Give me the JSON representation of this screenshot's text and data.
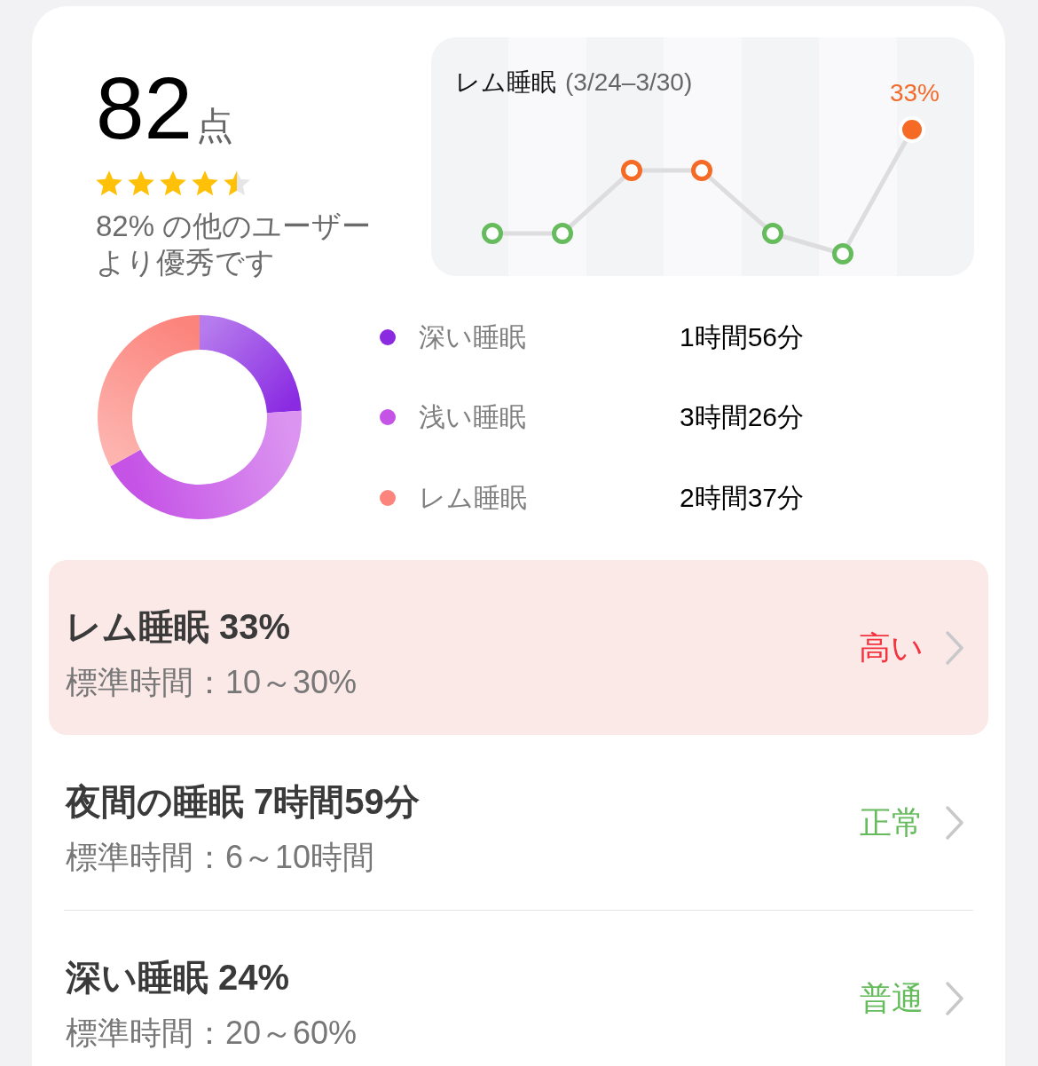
{
  "score": {
    "value": "82",
    "unit": "点",
    "stars": 4.5,
    "caption": "82% の他のユーザーより優秀です"
  },
  "rem_chart": {
    "title": "レム睡眠",
    "date_range": "(3/24–3/30)",
    "value_label": "33%"
  },
  "breakdown": {
    "chart_data": {
      "type": "donut",
      "values": [
        24,
        43,
        33
      ]
    },
    "legend": [
      {
        "label": "深い睡眠",
        "value": "1時間56分",
        "color": "#8a2be2"
      },
      {
        "label": "浅い睡眠",
        "value": "3時間26分",
        "color": "#c553e6"
      },
      {
        "label": "レム睡眠",
        "value": "2時間37分",
        "color": "#fb847c"
      }
    ]
  },
  "metrics": [
    {
      "title": "レム睡眠 33%",
      "range": "標準時間：10～30%",
      "status": "高い",
      "color": "#f5333f",
      "highlighted": true
    },
    {
      "title": "夜間の睡眠 7時間59分",
      "range": "標準時間：6～10時間",
      "status": "正常",
      "color": "#66bb5c",
      "highlighted": false
    },
    {
      "title": "深い睡眠 24%",
      "range": "標準時間：20～60%",
      "status": "普通",
      "color": "#66bb5c",
      "highlighted": false
    }
  ]
}
